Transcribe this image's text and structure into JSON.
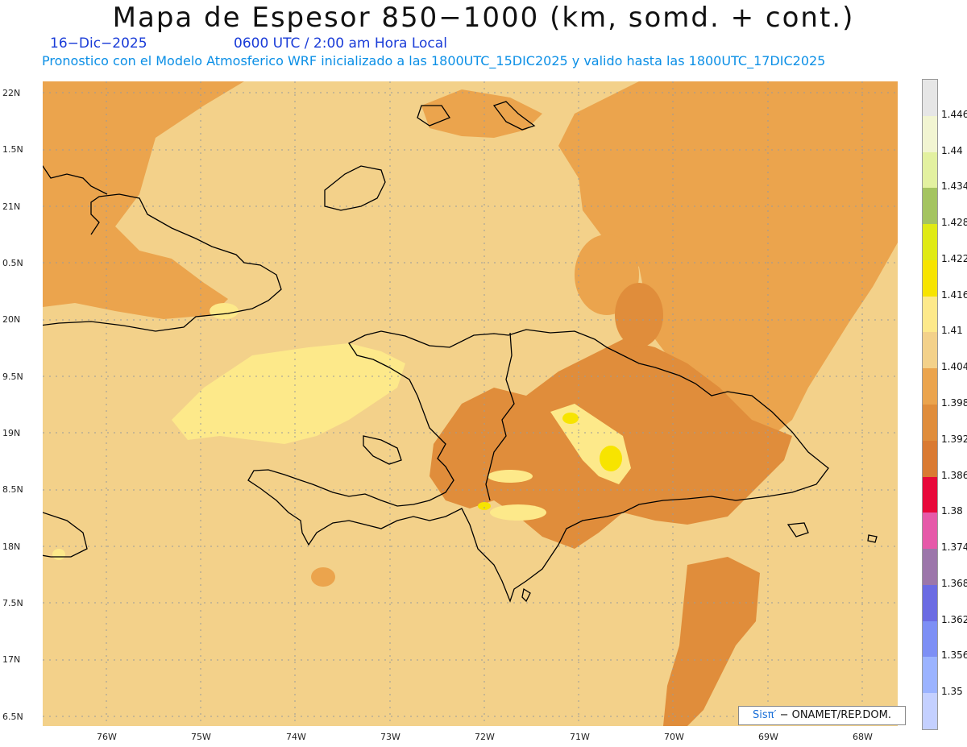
{
  "header": {
    "title": "Mapa de Espesor 850−1000 (km, somd. + cont.)",
    "date": "16−Dic−2025",
    "time": "0600 UTC / 2:00 am Hora Local",
    "forecast_note": "Pronostico con el Modelo Atmosferico WRF inicializado a las 1800UTC_15DIC2025 y valido hasta las  1800UTC_17DIC2025"
  },
  "axes": {
    "lat_labels": [
      "22N",
      "1.5N",
      "21N",
      "0.5N",
      "20N",
      "9.5N",
      "19N",
      "8.5N",
      "18N",
      "7.5N",
      "17N",
      "6.5N"
    ],
    "lon_labels": [
      "76W",
      "75W",
      "74W",
      "73W",
      "72W",
      "71W",
      "70W",
      "69W",
      "68W"
    ]
  },
  "colorbar": {
    "labels": [
      "1.446",
      "1.44",
      "1.434",
      "1.428",
      "1.422",
      "1.416",
      "1.41",
      "1.404",
      "1.398",
      "1.392",
      "1.386",
      "1.38",
      "1.374",
      "1.368",
      "1.362",
      "1.356",
      "1.35"
    ],
    "colors": [
      "#e6e6e6",
      "#f2f5d2",
      "#e3f1a0",
      "#a4c460",
      "#e0ea14",
      "#f7e400",
      "#fde98a",
      "#f3d18a",
      "#eba44d",
      "#e08d3b",
      "#da7a32",
      "#e8083a",
      "#e659a9",
      "#9c76aa",
      "#6b6be3",
      "#7d8ff5",
      "#9bb3ff",
      "#c4d0ff"
    ]
  },
  "map_colors": {
    "ocean_background": "#f3d18a",
    "orange_region": "#eba44d",
    "dark_orange_region": "#e08d3b",
    "yellow_region": "#fde98a",
    "bright_yellow": "#f7e400",
    "coastline": "#000000"
  },
  "credit": {
    "brand": "Sisπ′",
    "text": " − ONAMET/REP.DOM."
  }
}
